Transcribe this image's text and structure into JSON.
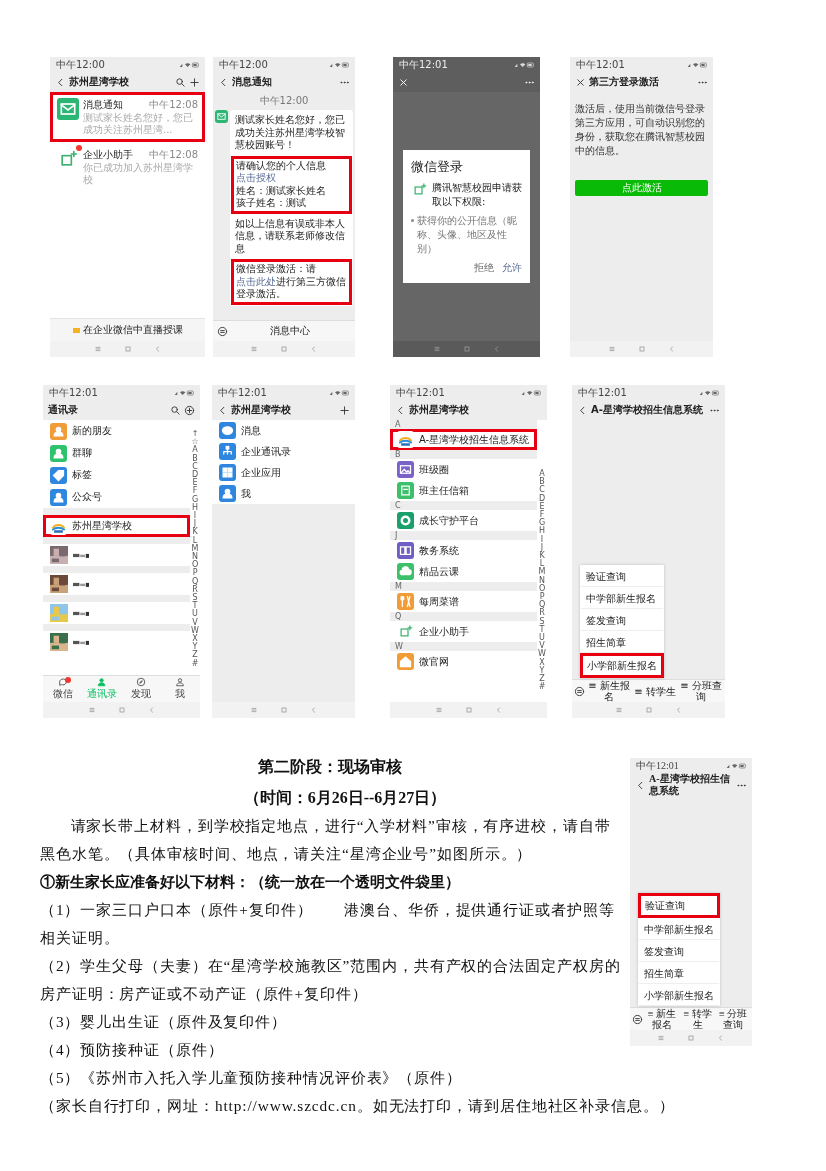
{
  "screenshots": [
    {
      "kind": "chat_list",
      "status_time": "中午12:00",
      "title": "苏州星湾学校",
      "items": [
        {
          "name": "消息通知",
          "preview": "测试家长姓名您好，您已成功关注苏州星湾...",
          "time": "中午12:08",
          "badge": false,
          "highlighted": true,
          "color": "#2bb673"
        },
        {
          "name": "企业小助手",
          "preview": "你已成功加入苏州星湾学校",
          "time": "中午12:08",
          "badge": true,
          "highlighted": false,
          "color": "#ffffff"
        }
      ],
      "footer": "在企业微信中直播授课"
    },
    {
      "kind": "message",
      "status_time": "中午12:00",
      "title": "消息通知",
      "timestamp": "中午12:00",
      "paragraphs": [
        {
          "highlighted": false,
          "lines": [
            [
              {
                "text": "测试家长姓名您好，您已成功关注苏州星湾学校智慧校园账号！",
                "link": false
              }
            ]
          ]
        },
        {
          "highlighted": true,
          "lines": [
            [
              {
                "text": "请确认您的个人信息",
                "link": false
              },
              {
                "text": "点击授权",
                "link": true
              }
            ],
            [
              {
                "text": "姓名：测试家长姓名",
                "link": false
              }
            ],
            [
              {
                "text": "孩子姓名：测试",
                "link": false
              }
            ]
          ]
        },
        {
          "highlighted": false,
          "lines": [
            [
              {
                "text": "如以上信息有误或非本人信息，请联系老师修改信息",
                "link": false
              }
            ]
          ]
        },
        {
          "highlighted": true,
          "lines": [
            [
              {
                "text": "微信登录激活：请",
                "link": false
              },
              {
                "text": "点击此处",
                "link": true
              },
              {
                "text": "进行第三方微信登录激活。",
                "link": false
              }
            ]
          ]
        }
      ],
      "footer": "消息中心"
    },
    {
      "kind": "dialog",
      "status_time": "中午12:01",
      "dialog": {
        "title": "微信登录",
        "request": "腾讯智慧校园申请获取以下权限:",
        "permission": "获得你的公开信息（昵称、头像、地区及性别）",
        "buttons": [
          {
            "label": "拒绝",
            "primary": false
          },
          {
            "label": "允许",
            "primary": true
          }
        ]
      }
    },
    {
      "kind": "activation",
      "status_time": "中午12:01",
      "title": "第三方登录激活",
      "text": "激活后，使用当前微信号登录第三方应用，可自动识别您的身份，获取您在腾讯智慧校园中的信息。",
      "button": "点此激活"
    },
    {
      "kind": "contacts",
      "status_time": "中午12:01",
      "title": "通讯录",
      "items": [
        {
          "kind": "entry",
          "name": "新的朋友",
          "color": "#f29c38",
          "highlighted": false
        },
        {
          "kind": "entry",
          "name": "群聊",
          "color": "#2dc26b",
          "highlighted": false
        },
        {
          "kind": "entry",
          "name": "标签",
          "color": "#2f86de",
          "highlighted": false
        },
        {
          "kind": "entry",
          "name": "公众号",
          "color": "#2f86de",
          "highlighted": false
        },
        {
          "kind": "section"
        },
        {
          "kind": "entry",
          "name": "苏州星湾学校",
          "color": "#ffffff",
          "highlighted": true
        },
        {
          "kind": "section"
        },
        {
          "kind": "redacted"
        },
        {
          "kind": "section"
        },
        {
          "kind": "redacted"
        },
        {
          "kind": "section"
        },
        {
          "kind": "redacted"
        },
        {
          "kind": "section"
        },
        {
          "kind": "redacted"
        }
      ],
      "index": [
        "↑",
        "☆",
        "A",
        "B",
        "C",
        "D",
        "E",
        "F",
        "G",
        "H",
        "I",
        "J",
        "K",
        "L",
        "M",
        "N",
        "O",
        "P",
        "Q",
        "R",
        "S",
        "T",
        "U",
        "V",
        "W",
        "X",
        "Y",
        "Z",
        "#"
      ],
      "tabs": [
        {
          "label": "微信",
          "selected": false,
          "badge": true
        },
        {
          "label": "通讯录",
          "selected": true,
          "badge": false
        },
        {
          "label": "发现",
          "selected": false,
          "badge": false
        },
        {
          "label": "我",
          "selected": false,
          "badge": false
        }
      ]
    },
    {
      "kind": "unit_menu",
      "status_time": "中午12:01",
      "title": "苏州星湾学校",
      "items": [
        {
          "name": "消息",
          "color": "#2f86de"
        },
        {
          "name": "企业通讯录",
          "color": "#2f86de"
        },
        {
          "name": "企业应用",
          "color": "#2f86de"
        },
        {
          "name": "我",
          "color": "#2f86de"
        }
      ]
    },
    {
      "kind": "app_list",
      "status_time": "中午12:01",
      "title": "苏州星湾学校",
      "sections": [
        {
          "letter": "A",
          "items": [
            {
              "name": "A-星湾学校招生信息系统",
              "color": "#ffffff",
              "highlighted": true
            }
          ]
        },
        {
          "letter": "B",
          "items": [
            {
              "name": "班级圈",
              "color": "#7b62c9",
              "highlighted": false
            },
            {
              "name": "班主任信箱",
              "color": "#3cc06a",
              "highlighted": false
            }
          ]
        },
        {
          "letter": "C",
          "items": [
            {
              "name": "成长守护平台",
              "color": "#1aa06a",
              "highlighted": false
            }
          ]
        },
        {
          "letter": "J",
          "items": [
            {
              "name": "教务系统",
              "color": "#6f5fc4",
              "highlighted": false
            },
            {
              "name": "精品云课",
              "color": "#3cc06a",
              "highlighted": false
            }
          ]
        },
        {
          "letter": "M",
          "items": [
            {
              "name": "每周菜谱",
              "color": "#f29c38",
              "highlighted": false
            }
          ]
        },
        {
          "letter": "Q",
          "items": [
            {
              "name": "企业小助手",
              "color": "#ffffff",
              "highlighted": false
            }
          ]
        },
        {
          "letter": "W",
          "items": [
            {
              "name": "微官网",
              "color": "#f29c38",
              "highlighted": false
            }
          ]
        }
      ],
      "index": [
        "A",
        "B",
        "C",
        "D",
        "E",
        "F",
        "G",
        "H",
        "I",
        "J",
        "K",
        "L",
        "M",
        "N",
        "O",
        "P",
        "Q",
        "R",
        "S",
        "T",
        "U",
        "V",
        "W",
        "X",
        "Y",
        "Z",
        "#"
      ]
    },
    {
      "kind": "menu_app",
      "status_time": "中午12:01",
      "title": "A-星湾学校招生信息系统",
      "popup": [
        {
          "label": "验证查询",
          "highlighted": false
        },
        {
          "label": "中学部新生报名",
          "highlighted": false
        },
        {
          "label": "签发查询",
          "highlighted": false
        },
        {
          "label": "招生简章",
          "highlighted": false
        },
        {
          "label": "小学部新生报名",
          "highlighted": true
        }
      ],
      "menus": [
        "≡ 新生报名",
        "≡ 转学生",
        "≡ 分班查询"
      ]
    }
  ],
  "document": {
    "heading": "第二阶段：现场审核",
    "subheading": "（时间：6月26日--6月27日）",
    "screenshot": {
      "kind": "menu_app",
      "status_time": "中午12:01",
      "title": "A-星湾学校招生信息系统",
      "popup": [
        {
          "label": "验证查询",
          "highlighted": true
        },
        {
          "label": "中学部新生报名",
          "highlighted": false
        },
        {
          "label": "签发查询",
          "highlighted": false
        },
        {
          "label": "招生简章",
          "highlighted": false
        },
        {
          "label": "小学部新生报名",
          "highlighted": false
        }
      ],
      "menus": [
        "≡ 新生报名",
        "≡ 转学生",
        "≡ 分班查询"
      ]
    },
    "paragraphs": [
      {
        "kind": "indent",
        "text": "请家长带上材料，到学校指定地点，进行“入学材料”审核，有序进校，请自带黑色水笔。（具体审核时间、地点，请关注“星湾企业号”如图所示。）"
      },
      {
        "kind": "bold",
        "text": "①新生家长应准备好以下材料：（统一放在一个透明文件袋里）"
      },
      {
        "kind": "plain",
        "text": "（1）一家三口户口本（原件+复印件）　　港澳台、华侨，提供通行证或者护照等相关证明。"
      },
      {
        "kind": "plain",
        "text": "（2）学生父母（夫妻）在“星湾学校施教区”范围内，共有产权的合法固定产权房的房产证明：房产证或不动产证（原件+复印件）"
      },
      {
        "kind": "plain",
        "text": "（3）婴儿出生证（原件及复印件）"
      },
      {
        "kind": "plain",
        "text": "（4）预防接种证（原件）"
      },
      {
        "kind": "plain",
        "text": "（5）《苏州市入托入学儿童预防接种情况评价表》（原件）"
      },
      {
        "kind": "plain",
        "text": "（家长自行打印，网址：http://www.szcdc.cn。如无法打印，请到居住地社区补录信息。）"
      }
    ]
  }
}
